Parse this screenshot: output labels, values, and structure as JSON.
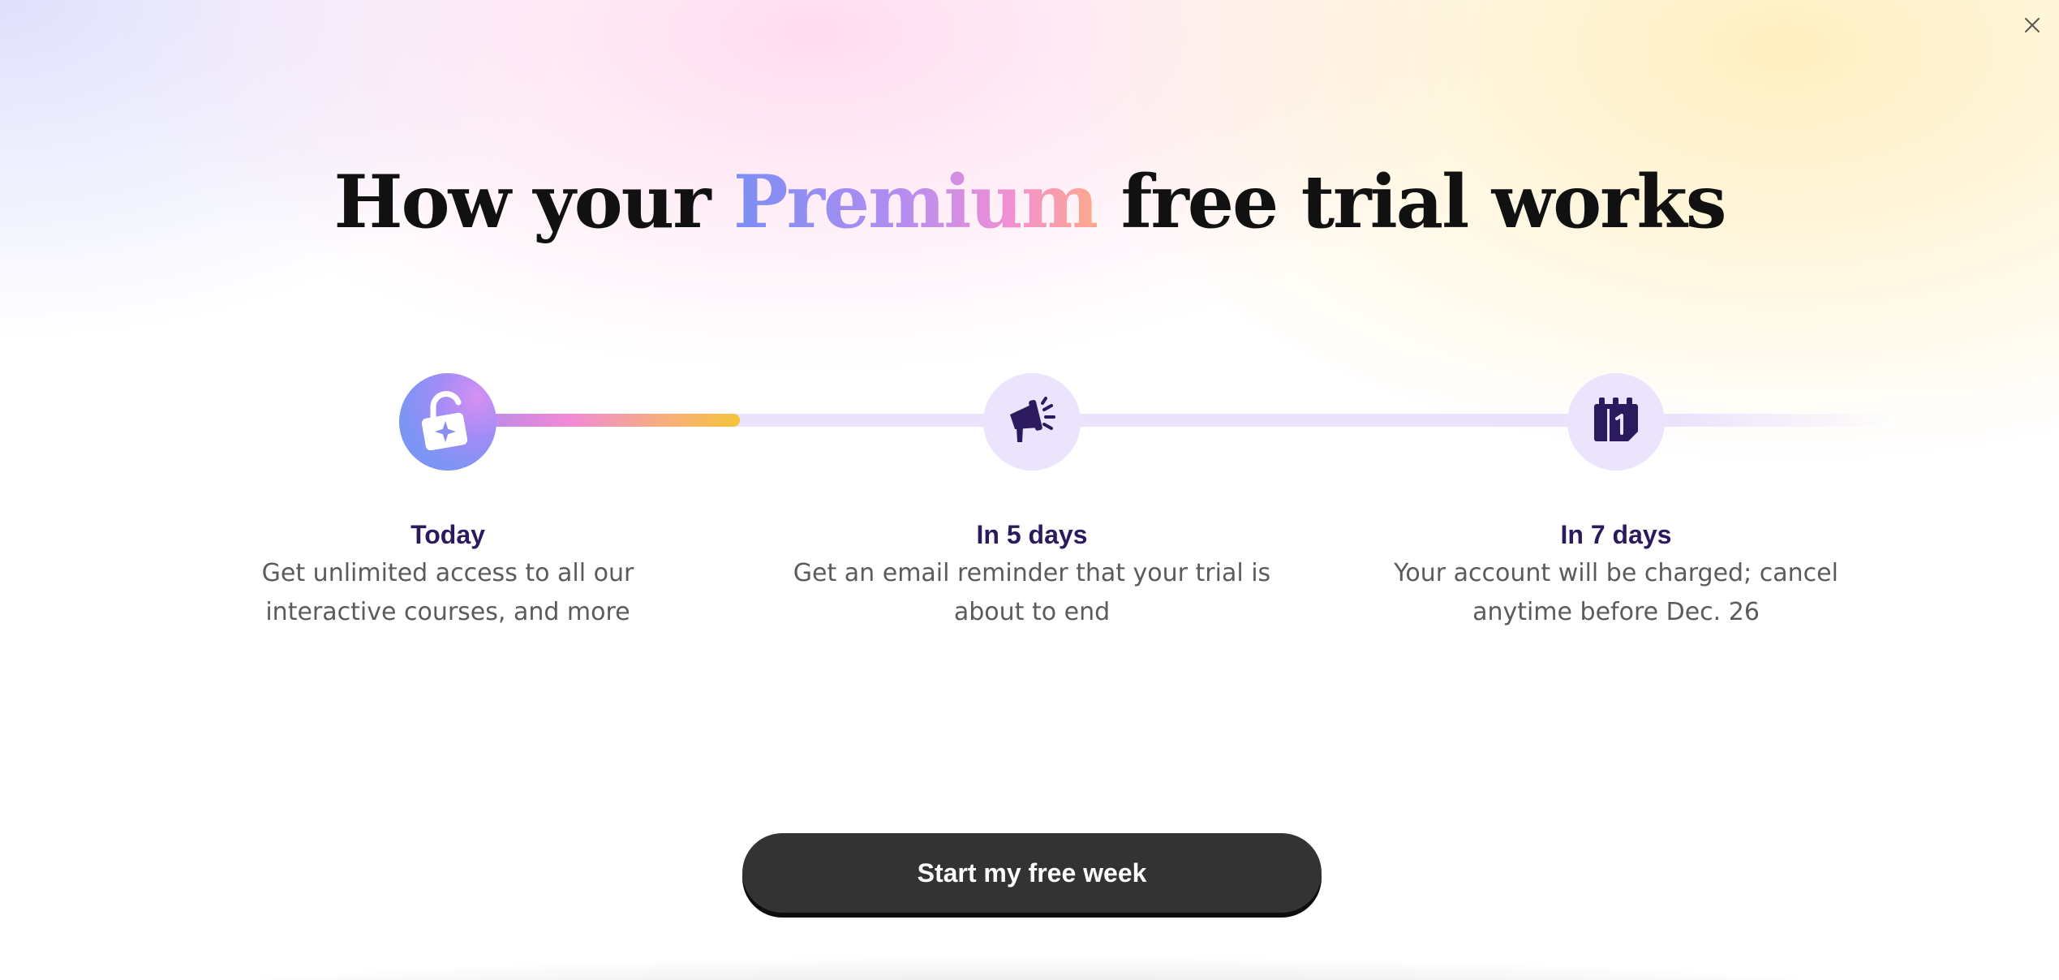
{
  "modal": {
    "close_icon": "close-icon",
    "title": {
      "before": "How your ",
      "highlight": "Premium",
      "after": " free trial works"
    },
    "colors": {
      "highlight_gradient": [
        "#7b8ef5",
        "#b18df0",
        "#ef8fd6",
        "#ffa88c"
      ],
      "step_title": "#2c1a5e",
      "cta_background": "#333333"
    },
    "timeline": {
      "progress_fraction": 0.2,
      "steps": [
        {
          "icon": "unlocked-padlock-sparkle-icon",
          "state": "active",
          "title": "Today",
          "description_line1": "Get unlimited access to all our",
          "description_line2": "interactive courses, and more"
        },
        {
          "icon": "megaphone-icon",
          "state": "pending",
          "title": "In 5 days",
          "description_line1": "Get an email reminder that your trial is",
          "description_line2": "about to end"
        },
        {
          "icon": "calendar-icon",
          "state": "pending",
          "title": "In 7 days",
          "description_line1": "Your account will be charged; cancel",
          "description_line2": "anytime before Dec. 26"
        }
      ]
    },
    "cta_label": "Start my free week"
  }
}
